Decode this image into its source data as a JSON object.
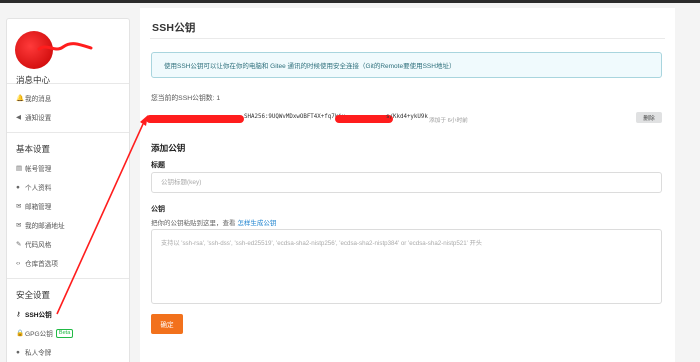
{
  "sidebar": {
    "sections": [
      {
        "title": "消息中心",
        "items": [
          {
            "icon": "bell-icon",
            "glyph": "🔔",
            "label": "我的消息"
          },
          {
            "icon": "volume-icon",
            "glyph": "◀",
            "label": "通知设置"
          }
        ]
      },
      {
        "title": "基本设置",
        "items": [
          {
            "icon": "id-card-icon",
            "glyph": "▤",
            "label": "帐号管理"
          },
          {
            "icon": "user-icon",
            "glyph": "●",
            "label": "个人资料"
          },
          {
            "icon": "mail-icon",
            "glyph": "✉",
            "label": "邮箱管理"
          },
          {
            "icon": "mail-notify-icon",
            "glyph": "✉",
            "label": "我的邮通地址"
          },
          {
            "icon": "brush-icon",
            "glyph": "✎",
            "label": "代码风格"
          },
          {
            "icon": "code-icon",
            "glyph": "‹›",
            "label": "仓库首选项"
          }
        ]
      },
      {
        "title": "安全设置",
        "items": [
          {
            "icon": "key-icon",
            "glyph": "⚷",
            "label": "SSH公钥",
            "active": true
          },
          {
            "icon": "lock-icon",
            "glyph": "🔒",
            "label": "GPG公钥",
            "badge": "Beta"
          },
          {
            "icon": "user-lock-icon",
            "glyph": "●",
            "label": "私人令牌"
          }
        ]
      }
    ]
  },
  "main": {
    "title": "SSH公钥",
    "info": "使用SSH公钥可以让你在你的电脑和 Gitee 通讯的时候使用安全连接（Git的Remote要使用SSH地址）",
    "key_count": "您当前的SSH公钥数: 1",
    "key": {
      "fingerprint": "SHA256:9UQWvMDxwOBFT4X+fq7kiy",
      "fingerprint_tail": "s/Kkd4+ykU9k",
      "added": "添加于 6小时前",
      "delete_label": "删除"
    },
    "add_section": {
      "heading": "添加公钥",
      "title_label": "标题",
      "title_placeholder": "公钥标题(key)",
      "key_label": "公钥",
      "hint_prefix": "把你的公钥粘贴到这里，查看",
      "hint_link": "怎样生成公钥",
      "key_placeholder": "支持以 'ssh-rsa', 'ssh-dss', 'ssh-ed25519', 'ecdsa-sha2-nistp256', 'ecdsa-sha2-nistp384' or 'ecdsa-sha2-nistp521' 开头",
      "submit_label": "确定"
    }
  },
  "colors": {
    "accent": "#f2711c",
    "link": "#2185d0",
    "info_bg": "#f0fafd",
    "info_border": "#a9d5de",
    "annotation_red": "#ff1d1d"
  }
}
